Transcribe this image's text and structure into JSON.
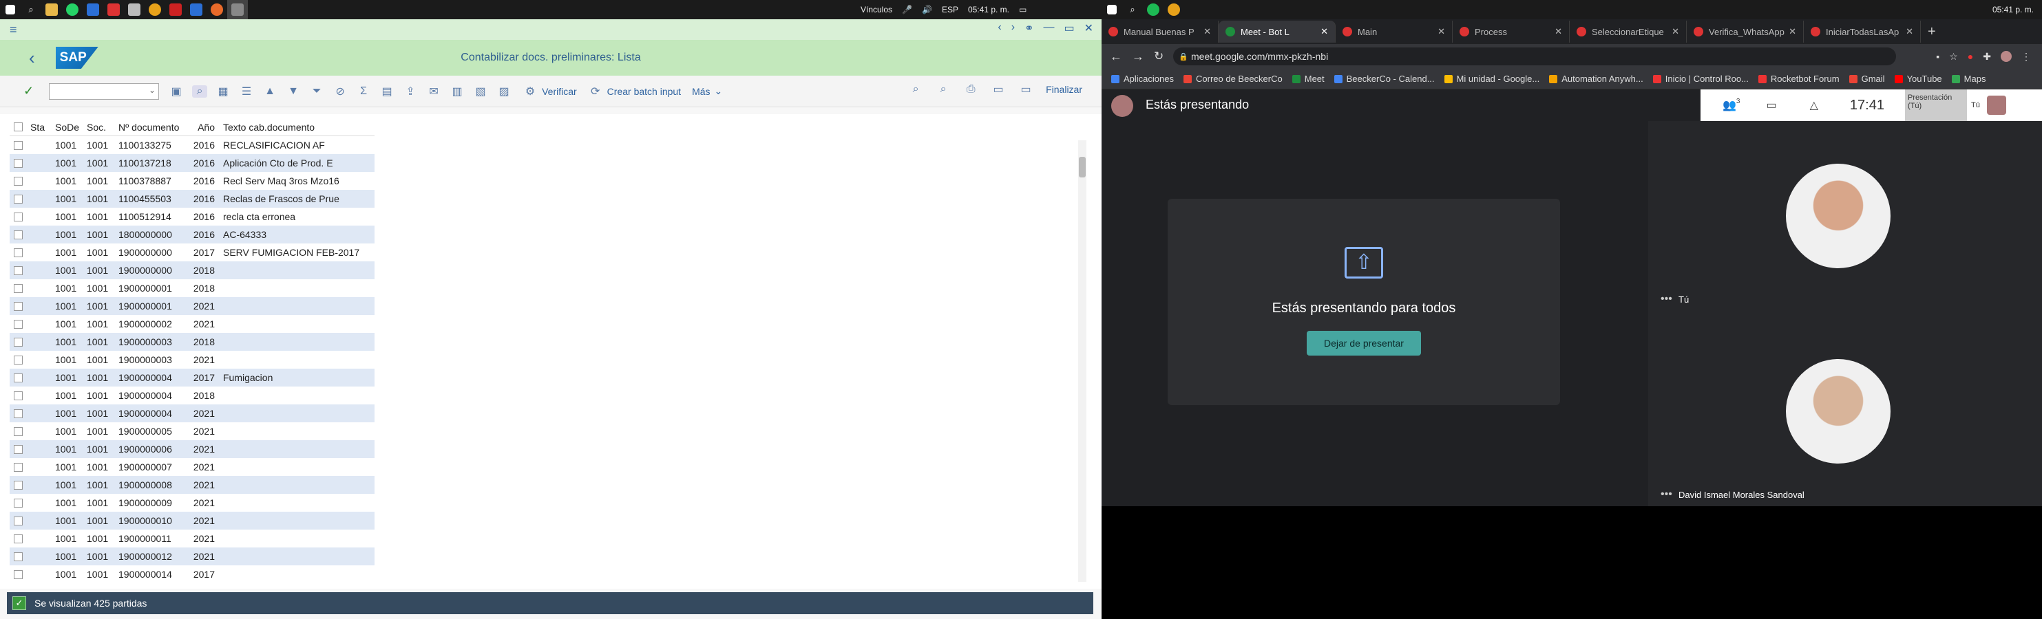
{
  "left_taskbar": {
    "links": "Vínculos",
    "lang": "ESP",
    "time": "05:41 p. m."
  },
  "sap": {
    "title": "Contabilizar docs. preliminares: Lista",
    "logo": "SAP",
    "toolbar": {
      "verify": "Verificar",
      "batch": "Crear batch input",
      "more": "Más",
      "finish": "Finalizar"
    },
    "columns": [
      "Sta",
      "SoDe",
      "Soc.",
      "Nº documento",
      "Año",
      "Texto cab.documento"
    ],
    "rows": [
      [
        "1001",
        "1001",
        "1100133275",
        "2016",
        "RECLASIFICACION AF"
      ],
      [
        "1001",
        "1001",
        "1100137218",
        "2016",
        "Aplicación Cto de Prod. E"
      ],
      [
        "1001",
        "1001",
        "1100378887",
        "2016",
        "Recl Serv Maq  3ros Mzo16"
      ],
      [
        "1001",
        "1001",
        "1100455503",
        "2016",
        "Reclas de Frascos de Prue"
      ],
      [
        "1001",
        "1001",
        "1100512914",
        "2016",
        "recla cta erronea"
      ],
      [
        "1001",
        "1001",
        "1800000000",
        "2016",
        "AC-64333"
      ],
      [
        "1001",
        "1001",
        "1900000000",
        "2017",
        "SERV FUMIGACION FEB-2017"
      ],
      [
        "1001",
        "1001",
        "1900000000",
        "2018",
        ""
      ],
      [
        "1001",
        "1001",
        "1900000001",
        "2018",
        ""
      ],
      [
        "1001",
        "1001",
        "1900000001",
        "2021",
        ""
      ],
      [
        "1001",
        "1001",
        "1900000002",
        "2021",
        ""
      ],
      [
        "1001",
        "1001",
        "1900000003",
        "2018",
        ""
      ],
      [
        "1001",
        "1001",
        "1900000003",
        "2021",
        ""
      ],
      [
        "1001",
        "1001",
        "1900000004",
        "2017",
        "Fumigacion"
      ],
      [
        "1001",
        "1001",
        "1900000004",
        "2018",
        ""
      ],
      [
        "1001",
        "1001",
        "1900000004",
        "2021",
        ""
      ],
      [
        "1001",
        "1001",
        "1900000005",
        "2021",
        ""
      ],
      [
        "1001",
        "1001",
        "1900000006",
        "2021",
        ""
      ],
      [
        "1001",
        "1001",
        "1900000007",
        "2021",
        ""
      ],
      [
        "1001",
        "1001",
        "1900000008",
        "2021",
        ""
      ],
      [
        "1001",
        "1001",
        "1900000009",
        "2021",
        ""
      ],
      [
        "1001",
        "1001",
        "1900000010",
        "2021",
        ""
      ],
      [
        "1001",
        "1001",
        "1900000011",
        "2021",
        ""
      ],
      [
        "1001",
        "1001",
        "1900000012",
        "2021",
        ""
      ],
      [
        "1001",
        "1001",
        "1900000014",
        "2017",
        ""
      ]
    ],
    "status": "Se visualizan 425 partidas"
  },
  "right_taskbar": {
    "time": "05:41 p. m."
  },
  "chrome": {
    "tabs": [
      "Manual Buenas P",
      "Meet - Bot L",
      "Main",
      "Process",
      "SeleccionarEtique",
      "Verifica_WhatsApp",
      "IniciarTodasLasAp"
    ],
    "url": "meet.google.com/mmx-pkzh-nbi",
    "bookmarks": [
      "Aplicaciones",
      "Correo de BeeckerCo",
      "Meet",
      "BeeckerCo - Calend...",
      "Mi unidad - Google...",
      "Automation Anywh...",
      "Inicio | Control Roo...",
      "Rocketbot Forum",
      "Gmail",
      "YouTube",
      "Maps"
    ]
  },
  "meet": {
    "presenting": "Estás presentando",
    "clock": "17:41",
    "participants_count": "3",
    "presentation_label": "Presentación (Tú)",
    "you_short": "Tú",
    "panel_title": "Estás presentando para todos",
    "stop_button": "Dejar de presentar",
    "tile1_name": "Tú",
    "tile2_name": "David Ismael Morales Sandoval"
  }
}
